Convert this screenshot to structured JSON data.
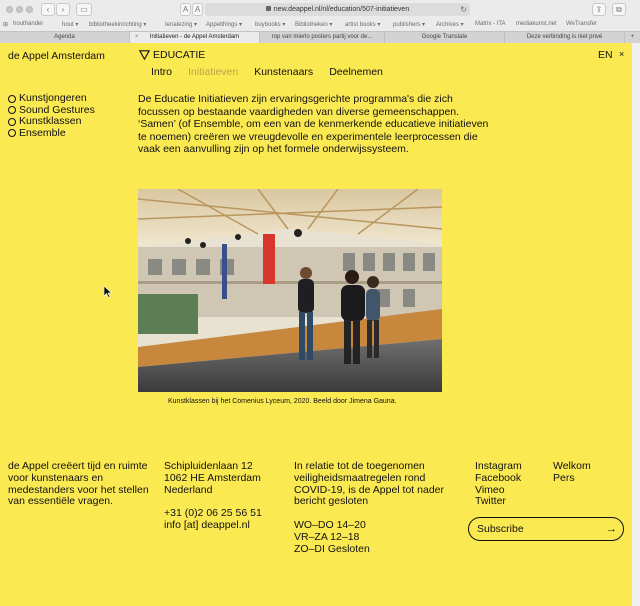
{
  "browser": {
    "url": "new.deappel.nl/nl/education/507-initiatieven",
    "toolbar_aa_small": "A",
    "toolbar_aa_large": "A",
    "bookmarks": [
      "houthandel",
      "hout ▾",
      "bibliotheekinrichting ▾",
      "Ienalezing ▾",
      "Appelthings ▾",
      "buybooks ▾",
      "Bibliotheken ▾",
      "artist books ▾",
      "publishers ▾",
      "Archives ▾",
      "Matrix - ITA",
      "mediakunst.net",
      "WeTransfer"
    ],
    "tabs": [
      {
        "label": "Agenda"
      },
      {
        "label": "Initiatieven - de Appel Amsterdam"
      },
      {
        "label": "rop van mierlo posters partij voor de..."
      },
      {
        "label": "Google Translate"
      },
      {
        "label": "Deze verbinding is niet privé"
      }
    ],
    "new_tab": "+"
  },
  "site": {
    "logo": "de Appel Amsterdam",
    "section": "EDUCATIE",
    "subnav": [
      "Intro",
      "Initiatieven",
      "Kunstenaars",
      "Deelnemen"
    ],
    "lang": "EN",
    "close": "×"
  },
  "sidebar": {
    "items": [
      "Kunstjongeren",
      "Sound Gestures",
      "Kunstklassen",
      "Ensemble"
    ]
  },
  "intro_text": "De Educatie Initiatieven zijn ervaringsgerichte programma's die zich focussen op bestaande vaardigheden van diverse gemeenschappen. ‘Samen’ (of Ensemble, om een van de kenmerkende educatieve initiatieven te noemen) creëren we vreugdevolle en experimentele leerprocessen die vaak een aanvulling zijn op het formele onderwijssysteem.",
  "photo_caption": "Kunstklassen bij het Comenius Lyceum, 2020. Beeld door Jimena Gauna.",
  "footer": {
    "mission": "de Appel creëert tijd en ruimte voor kunstenaars en medestanders voor het stellen van essentiële vragen.",
    "address": [
      "Schipluidenlaan 12",
      "1062 HE Amsterdam",
      "Nederland"
    ],
    "phone": "+31 (0)2 06 25 56 51",
    "email": "info [at] deappel.nl",
    "covid_notice": "In relatie tot de toegenomen veiligheidsmaatregelen rond COVID-19, is de Appel tot nader bericht gesloten",
    "hours": [
      "WO–DO 14–20",
      "VR–ZA 12–18",
      "ZO–DI Gesloten"
    ],
    "social": [
      "Instagram",
      "Facebook",
      "Vimeo",
      "Twitter"
    ],
    "links": [
      "Welkom",
      "Pers"
    ],
    "subscribe_label": "Subscribe"
  },
  "colors": {
    "page_bg": "#fbe952",
    "text": "#111111",
    "nav_active": "#b7a64c"
  }
}
